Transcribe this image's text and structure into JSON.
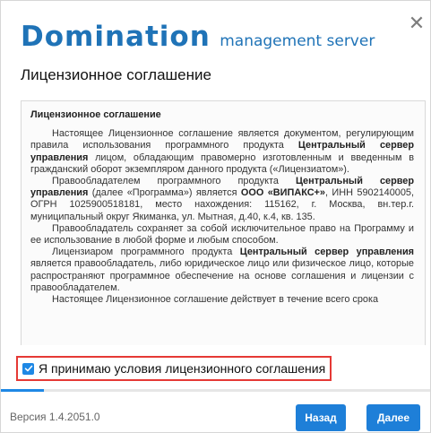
{
  "logo": {
    "brand": "Domination",
    "subtitle": "management server"
  },
  "dialog": {
    "title": "Лицензионное соглашение",
    "close_glyph": "✕"
  },
  "license": {
    "heading": "Лицензионное соглашение",
    "p1_a": "Настоящее Лицензионное соглашение является документом, регулирующим правила использования программного продукта ",
    "p1_b": "Центральный сервер управления",
    "p1_c": " лицом, обладающим правомерно изготовленным и введенным в гражданский оборот экземпляром данного продукта («Лицензиатом»).",
    "p2_a": "Правообладателем программного продукта ",
    "p2_b": "Центральный сервер управления",
    "p2_c": " (далее «Программа») является ",
    "p2_d": "ООО «ВИПАКС+»",
    "p2_e": ", ИНН 5902140005, ОГРН 1025900518181, место нахождения: 115162, г. Москва, вн.тер.г. муниципальный округ Якиманка, ул. Мытная, д.40, к.4, кв. 135.",
    "p3": "Правообладатель сохраняет за собой исключительное право на Программу и ее использование в любой форме и любым способом.",
    "p4_a": "Лицензиаром программного продукта ",
    "p4_b": "Центральный сервер управления",
    "p4_c": " является правообладатель, либо юридическое лицо или физическое лицо, которые распространяют программное обеспечение на основе соглашения и лицензии с правообладателем.",
    "p5": "Настоящее Лицензионное соглашение действует в течение всего срока"
  },
  "accept": {
    "label": "Я принимаю условия лицензионного соглашения",
    "checked": true
  },
  "progress": {
    "fraction": 0.1
  },
  "footer": {
    "version": "Версия  1.4.2051.0",
    "back_label": "Назад",
    "next_label": "Далее"
  },
  "colors": {
    "accent": "#1e7fd8",
    "highlight_border": "#e53935",
    "brand": "#1f73b7"
  },
  "icons": {
    "close": "close-icon",
    "checkbox": "checkmark-icon"
  }
}
